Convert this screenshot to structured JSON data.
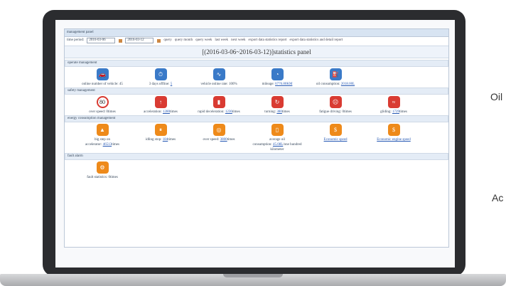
{
  "side": {
    "oil": "Oil",
    "ac": "Ac"
  },
  "panel_title": "management panel",
  "toolbar": {
    "time_label": "time period:",
    "date_from": "2016-03-06",
    "date_to": "2016-03-12",
    "btn_query": "query",
    "btn_query_month": "query month",
    "btn_query_week": "query week",
    "btn_last_week": "last week",
    "btn_next_week": "next week",
    "btn_export_stat": "export data statistics report",
    "btn_export_detail": "export data statistics and detail report"
  },
  "stats_title": "[(2016-03-06~2016-03-12)]statistics panel",
  "colors": {
    "blue": "#3a7ac8",
    "red": "#d93b32",
    "orange": "#ee8a1a"
  },
  "sections": [
    {
      "title": "operate management",
      "items": [
        {
          "icon": "car-icon",
          "label": "online number of vehicle: ",
          "value": "45",
          "underline": false
        },
        {
          "icon": "clock-icon",
          "label": "3 days offline: ",
          "value": "5",
          "underline": true
        },
        {
          "icon": "chart-icon",
          "label": "vehicle online rate: ",
          "value": "100%",
          "underline": false
        },
        {
          "icon": "odometer-icon",
          "label": "mileage: ",
          "value": "6776.80KM",
          "underline": true
        },
        {
          "icon": "fuel-pump-icon",
          "label": "oil consumption: ",
          "value": "2018.00L",
          "underline": true
        }
      ]
    },
    {
      "title": "safety management",
      "items": [
        {
          "icon": "speed-limit-80-icon",
          "label": "over speed: ",
          "value": "0times",
          "underline": false
        },
        {
          "icon": "acceleration-icon",
          "label": "acceleration: ",
          "value": "1280",
          "suffix": "times",
          "underline": true
        },
        {
          "icon": "brake-icon",
          "label": "rapid deceleration: ",
          "value": "1236",
          "suffix": "times",
          "underline": true
        },
        {
          "icon": "turning-icon",
          "label": "turning: ",
          "value": "380",
          "suffix": "times",
          "underline": true
        },
        {
          "icon": "fatigue-icon",
          "label": "fatigue driving: ",
          "value": "0times",
          "underline": false
        },
        {
          "icon": "gliding-icon",
          "label": "gliding: ",
          "value": "1729",
          "suffix": "times",
          "underline": true
        }
      ]
    },
    {
      "title": "energy consumption management",
      "items": [
        {
          "icon": "big-step-icon",
          "label": "big step on",
          "label2": "accelerator: ",
          "value": "46513",
          "suffix": "times",
          "underline": true
        },
        {
          "icon": "idling-icon",
          "label": "idling stop: ",
          "value": "184",
          "suffix": "times",
          "underline": true
        },
        {
          "icon": "over-speed-gauge-icon",
          "label": "over speed: ",
          "value": "3800",
          "suffix": "times",
          "underline": true
        },
        {
          "icon": "oil-average-icon",
          "label": "average oil",
          "label2": "consumption: ",
          "value": "45.08L",
          "suffix": "/one hundred",
          "label3": "kilometer",
          "underline": true
        },
        {
          "icon": "economic-speed-icon",
          "link": "Economic speed"
        },
        {
          "icon": "economic-engine-icon",
          "link": "Economic engine speed"
        }
      ]
    },
    {
      "title": "fault alarm",
      "items": [
        {
          "icon": "engine-fault-icon",
          "label": "fault statistics: ",
          "value": "0times",
          "underline": false
        }
      ]
    }
  ]
}
